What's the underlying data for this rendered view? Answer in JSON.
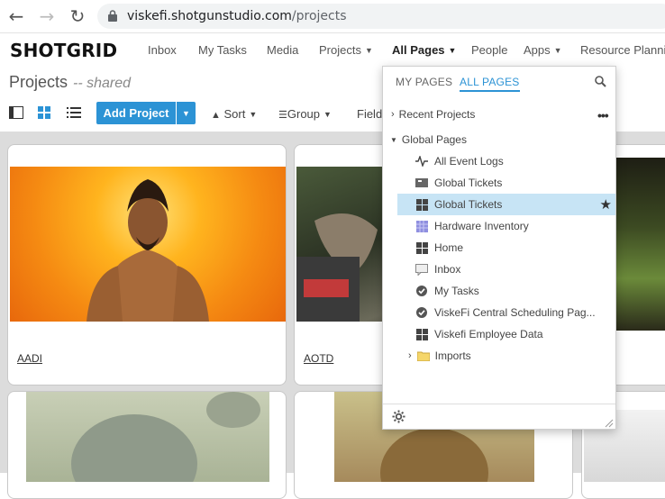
{
  "browser": {
    "url_host": "viskefi.shotgunstudio.com",
    "url_path": "/projects"
  },
  "nav": {
    "logo": "SHOTGRID",
    "items": [
      "Inbox",
      "My Tasks",
      "Media",
      "Projects",
      "All Pages",
      "People",
      "Apps",
      "Resource Planning"
    ]
  },
  "page": {
    "title": "Projects",
    "subtitle": "-- shared"
  },
  "toolbar": {
    "add_project": "Add Project",
    "sort": "Sort",
    "group": "Group",
    "fields": "Field"
  },
  "projects": [
    "AADI",
    "AOTD"
  ],
  "dropdown": {
    "tabs": [
      "MY PAGES",
      "ALL PAGES"
    ],
    "recent_projects": "Recent Projects",
    "global_pages": "Global Pages",
    "items": [
      {
        "label": "All Event Logs",
        "icon": "activity-icon"
      },
      {
        "label": "Global Tickets",
        "icon": "ticket-icon"
      },
      {
        "label": "Global Tickets",
        "icon": "grid-icon",
        "selected": true
      },
      {
        "label": "Hardware Inventory",
        "icon": "inventory-icon"
      },
      {
        "label": "Home",
        "icon": "grid-icon"
      },
      {
        "label": "Inbox",
        "icon": "inbox-icon"
      },
      {
        "label": "My Tasks",
        "icon": "check-icon"
      },
      {
        "label": "ViskeFi Central Scheduling Pag...",
        "icon": "check-icon"
      },
      {
        "label": "Viskefi Employee Data",
        "icon": "grid-icon"
      }
    ],
    "imports": "Imports"
  },
  "colors": {
    "accent": "#2c93d5",
    "selected_row": "#c7e4f5"
  }
}
